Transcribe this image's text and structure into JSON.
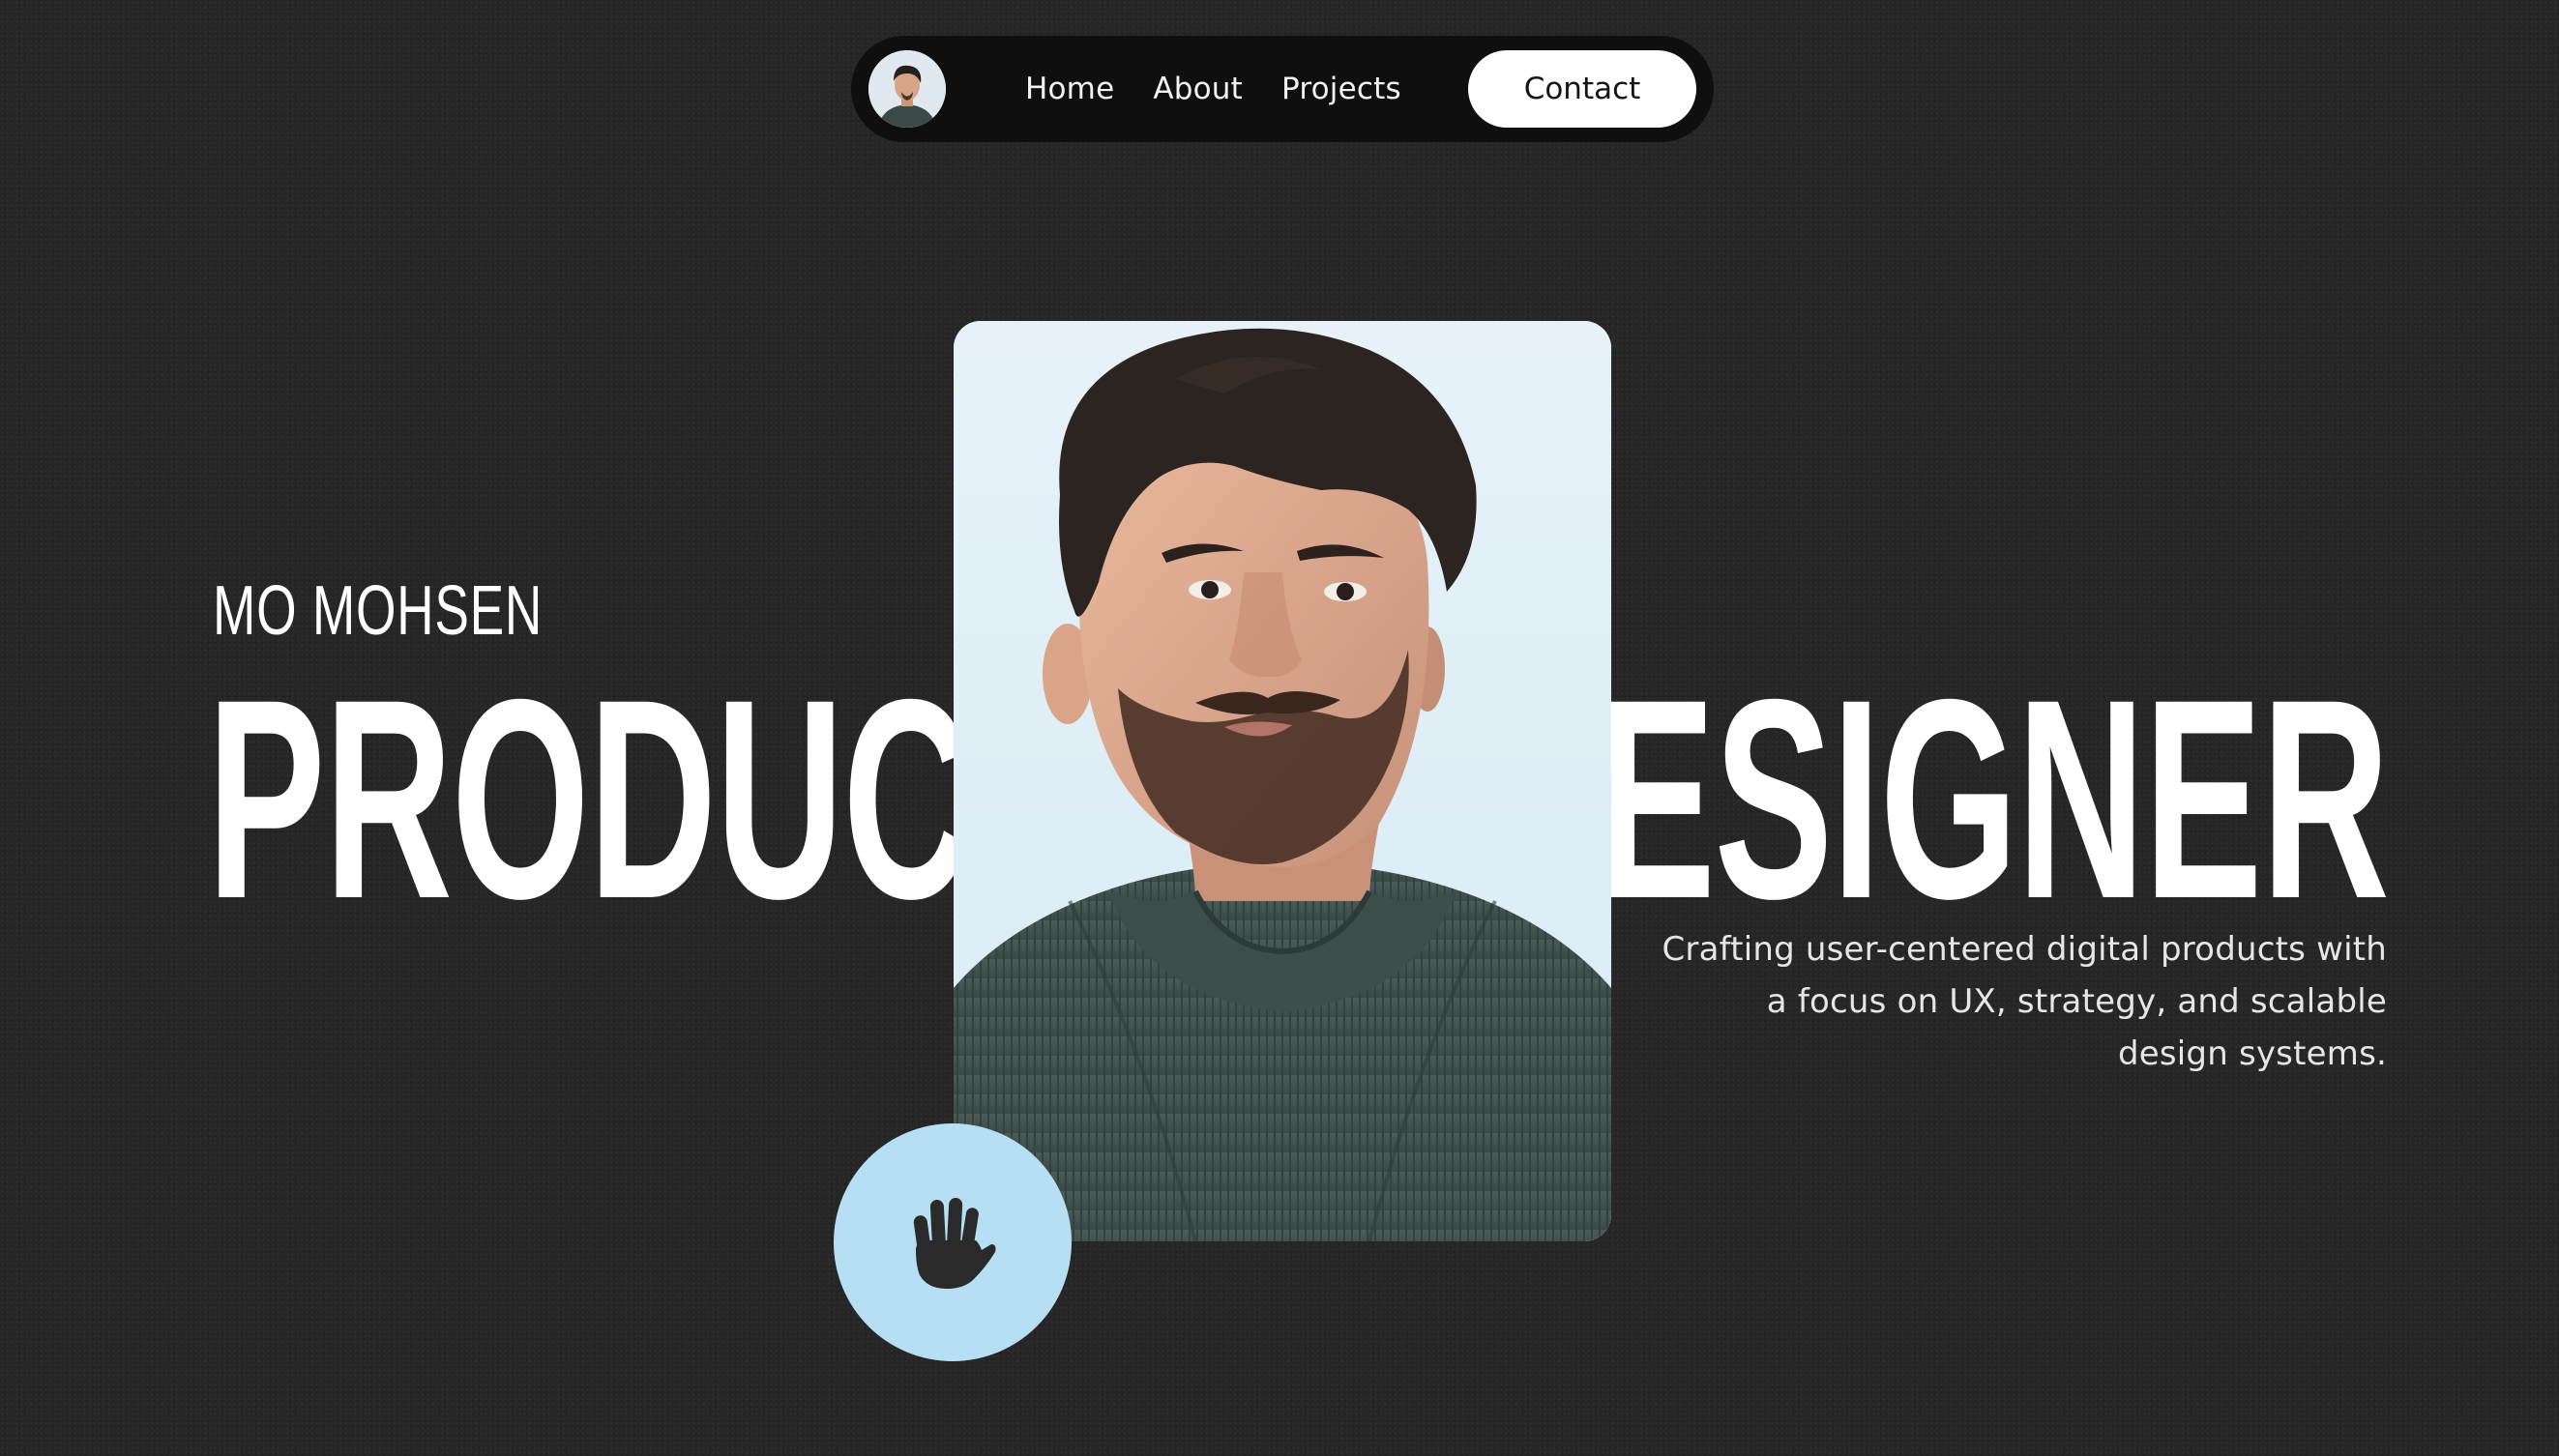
{
  "nav": {
    "links": [
      {
        "label": "Home"
      },
      {
        "label": "About"
      },
      {
        "label": "Projects"
      }
    ],
    "contact_label": "Contact",
    "avatar_icon": "person-avatar"
  },
  "hero": {
    "name": "MO MOHSEN",
    "headline_left": "PRODUCT",
    "headline_right": "DESIGNER",
    "tagline": "Crafting user-centered digital products with a focus on UX, strategy, and scalable design systems.",
    "portrait_icon": "portrait-photo",
    "wave_icon": "waving-hand-icon"
  },
  "colors": {
    "background": "#262626",
    "nav_background": "#0f0f0f",
    "contact_button": "#ffffff",
    "wave_button": "#b6dff3",
    "portrait_background": "#e4f1f7",
    "text": "#ffffff"
  }
}
